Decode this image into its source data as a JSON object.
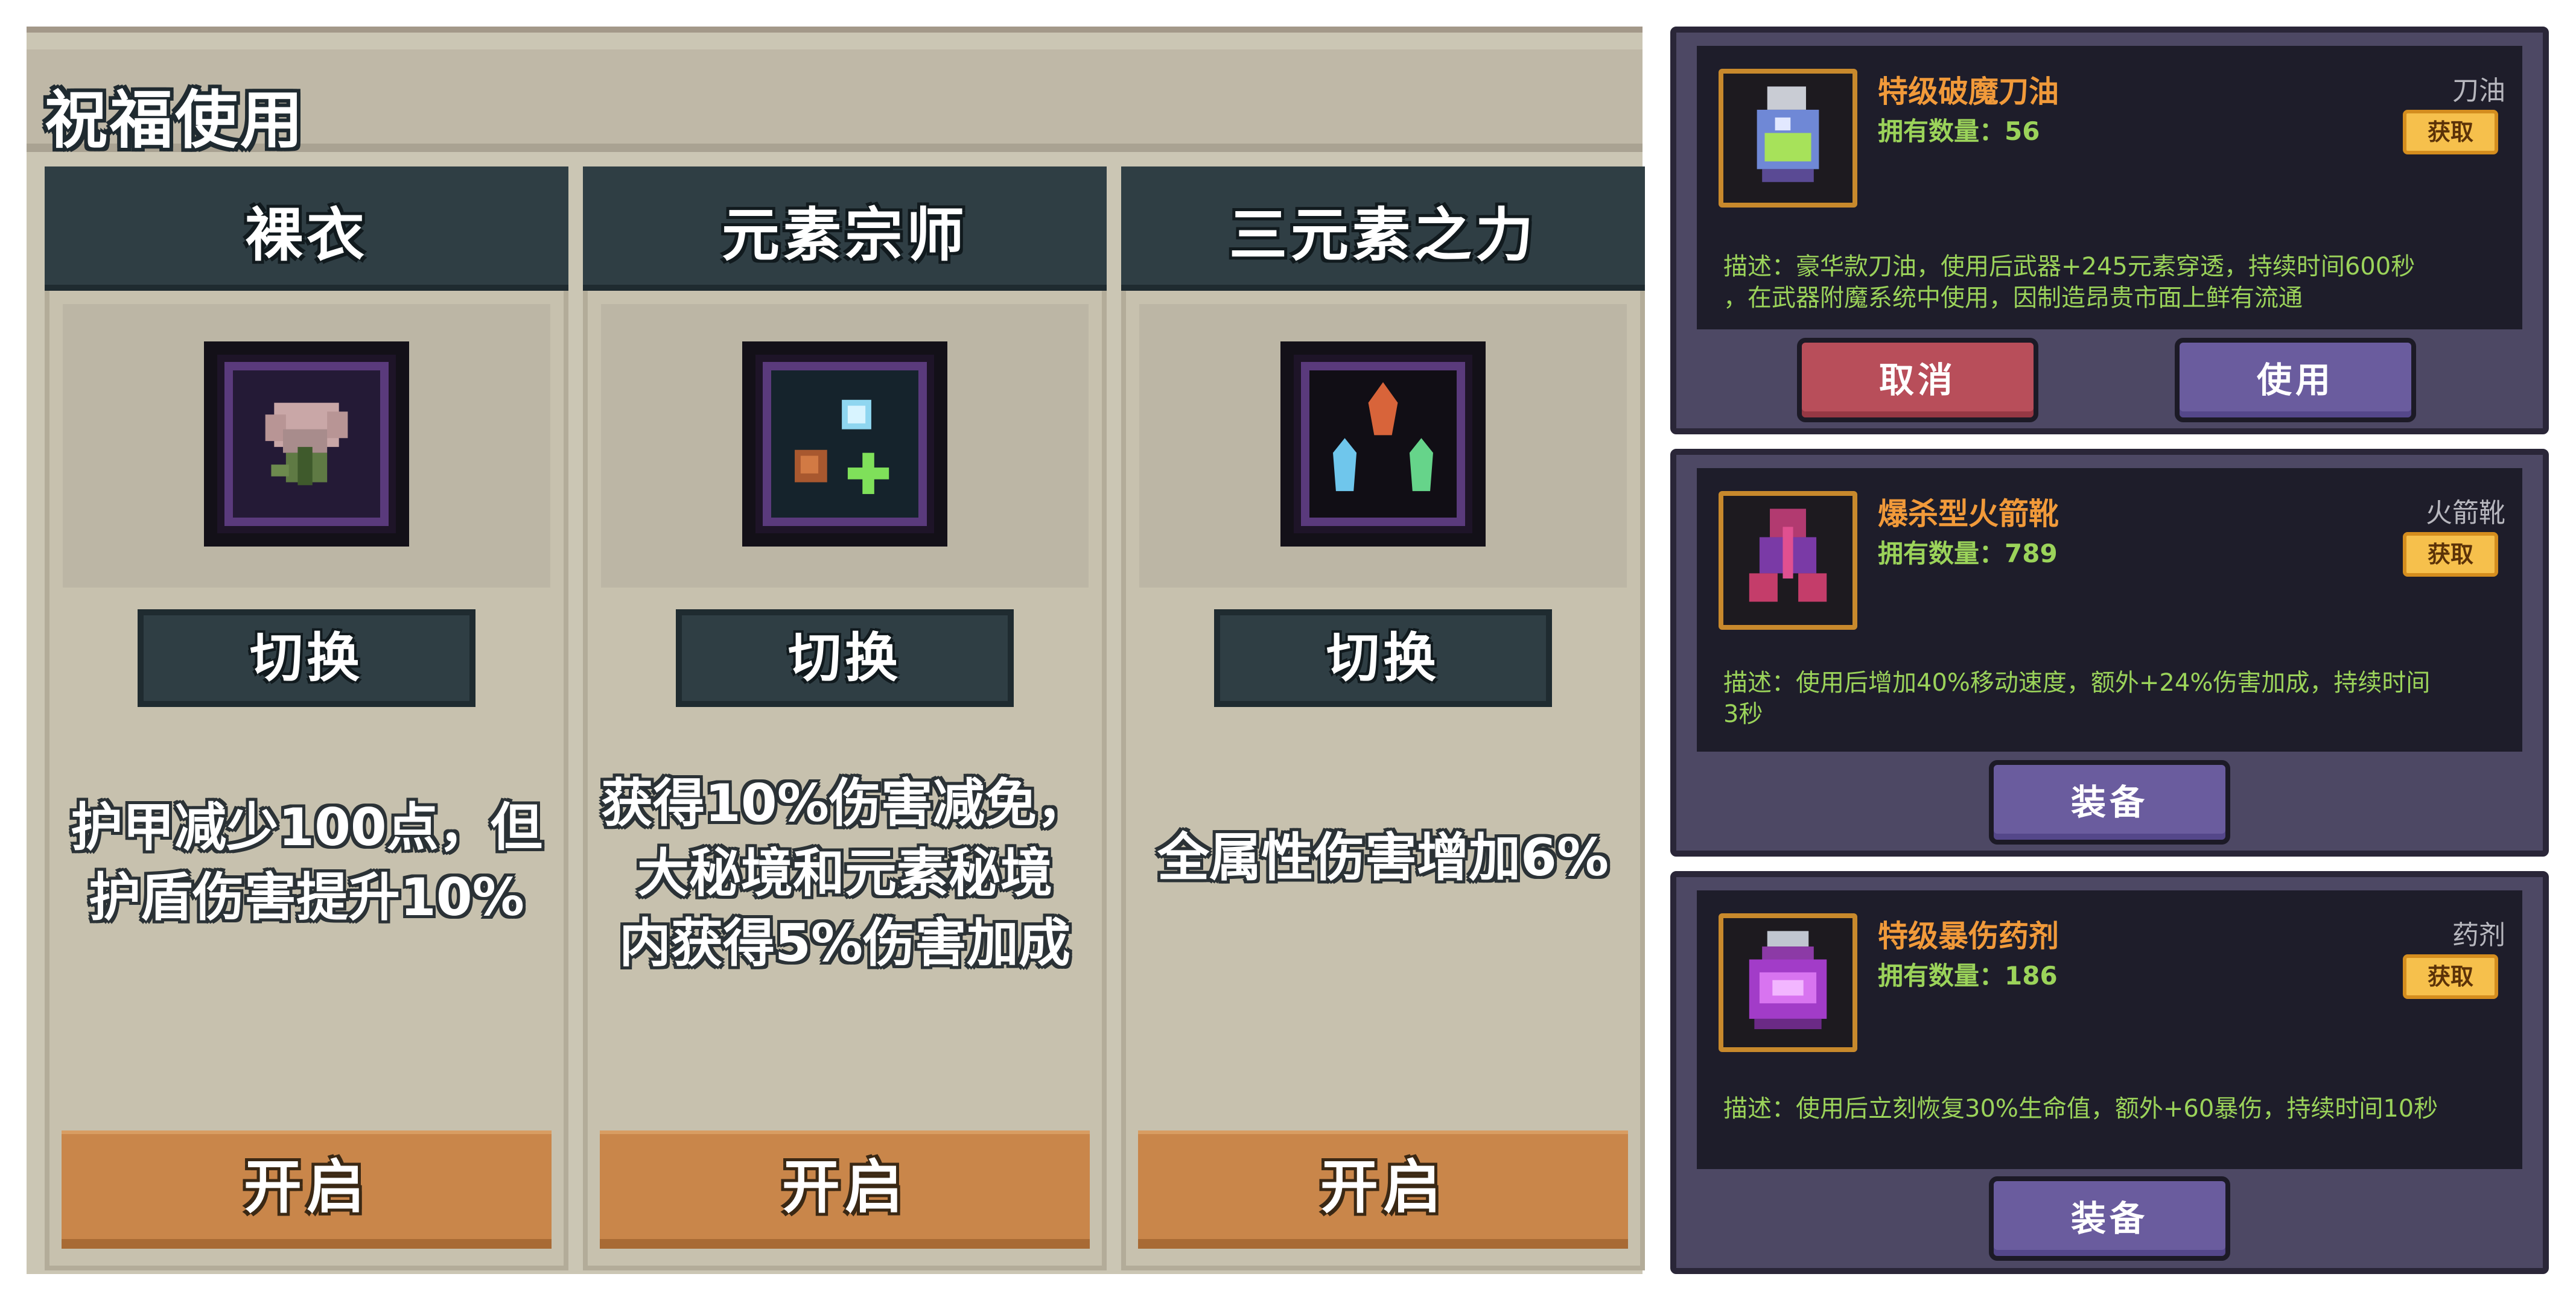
{
  "left": {
    "title": "祝福使用",
    "cards": [
      {
        "name": "裸衣",
        "switch_label": "切换",
        "desc_lines": [
          "护甲减少100点，但",
          "护盾伤害提升10%"
        ],
        "open_label": "开启"
      },
      {
        "name": "元素宗师",
        "switch_label": "切换",
        "desc_lines": [
          "获得10%伤害减免，",
          "大秘境和元素秘境",
          "内获得5%伤害加成"
        ],
        "open_label": "开启"
      },
      {
        "name": "三元素之力",
        "switch_label": "切换",
        "desc_lines": [
          "全属性伤害增加6%"
        ],
        "open_label": "开启"
      }
    ]
  },
  "right": {
    "items": [
      {
        "name": "特级破魔刀油",
        "type": "刀油",
        "count_label": "拥有数量：56",
        "get_label": "获取",
        "desc_lines": [
          "描述：豪华款刀油，使用后武器+245元素穿透，持续时间600秒",
          "，在武器附魔系统中使用，因制造昂贵市面上鲜有流通"
        ],
        "cancel_label": "取消",
        "use_label": "使用"
      },
      {
        "name": "爆杀型火箭靴",
        "type": "火箭靴",
        "count_label": "拥有数量：789",
        "get_label": "获取",
        "desc_lines": [
          "描述：使用后增加40%移动速度，额外+24%伤害加成，持续时间",
          "3秒"
        ],
        "equip_label": "装备"
      },
      {
        "name": "特级暴伤药剂",
        "type": "药剂",
        "count_label": "拥有数量：186",
        "get_label": "获取",
        "desc_lines": [
          "描述：使用后立刻恢复30%生命值，额外+60暴伤，持续时间10秒"
        ],
        "equip_label": "装备"
      }
    ]
  },
  "colors": {
    "left_bg": "#cbc6b4",
    "card_head": "#2f3e44",
    "open_button": "#c9864a",
    "right_card": "#4d4864",
    "item_name": "#f19a3a",
    "item_green": "#9bd35a",
    "get_button": "#f6c04c"
  },
  "icons": [
    "flower-blessing-icon",
    "element-orbs-icon",
    "three-crystals-icon",
    "oil-flask-icon",
    "rocket-boots-icon",
    "potion-jar-icon"
  ]
}
